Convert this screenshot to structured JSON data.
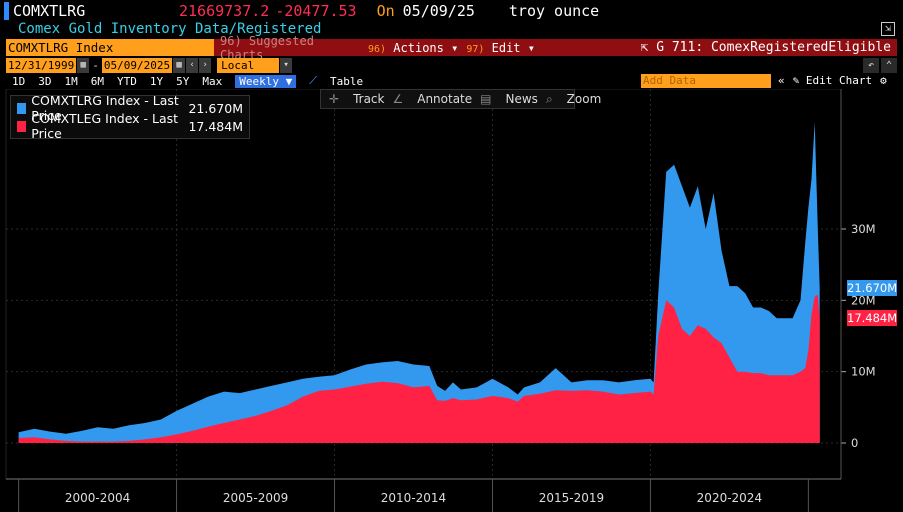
{
  "header": {
    "ticker": "COMXTLRG",
    "price": "21669737.2",
    "change": "-20477.53",
    "on_label": "On",
    "date": "05/09/25",
    "unit": "troy ounce",
    "subtitle": "Comex Gold Inventory Data/Registered"
  },
  "toolbar": {
    "security": "COMXTLRG Index",
    "suggested": "96) Suggested Charts",
    "actions_num": "96)",
    "actions": "Actions",
    "edit_num": "97)",
    "edit": "Edit",
    "graph_title": "G 711: ComexRegisteredEligible"
  },
  "range": {
    "start": "12/31/1999",
    "end": "05/09/2025",
    "currency": "Local CCY",
    "buttons": [
      "1D",
      "3D",
      "1M",
      "6M",
      "YTD",
      "1Y",
      "5Y",
      "Max"
    ],
    "frequency": "Weekly",
    "table": "Table",
    "add_data": "Add Data",
    "edit_chart": "Edit Chart"
  },
  "chart_tools": {
    "track": "Track",
    "annotate": "Annotate",
    "news": "News",
    "zoom": "Zoom"
  },
  "colors": {
    "registered": "#3399ee",
    "eligible": "#ff2244"
  },
  "chart_data": {
    "type": "area",
    "y_axis_side": "right",
    "ylim": [
      -1.2,
      46
    ],
    "y_ticks": [
      "0",
      "10M",
      "20M",
      "30M"
    ],
    "x_ticks": [
      "2000-2004",
      "2005-2009",
      "2010-2014",
      "2015-2019",
      "2020-2024"
    ],
    "x": [
      2000.0,
      2000.5,
      2001.0,
      2001.5,
      2002.0,
      2002.5,
      2003.0,
      2003.5,
      2004.0,
      2004.5,
      2005.0,
      2005.5,
      2006.0,
      2006.5,
      2007.0,
      2007.5,
      2008.0,
      2008.5,
      2009.0,
      2009.5,
      2010.0,
      2010.5,
      2011.0,
      2011.5,
      2012.0,
      2012.5,
      2013.0,
      2013.25,
      2013.5,
      2013.75,
      2014.0,
      2014.5,
      2015.0,
      2015.5,
      2015.8,
      2016.0,
      2016.5,
      2017.0,
      2017.5,
      2018.0,
      2018.5,
      2019.0,
      2019.5,
      2020.0,
      2020.1,
      2020.25,
      2020.5,
      2020.75,
      2021.0,
      2021.25,
      2021.5,
      2021.75,
      2022.0,
      2022.25,
      2022.5,
      2022.75,
      2023.0,
      2023.25,
      2023.5,
      2023.75,
      2024.0,
      2024.25,
      2024.5,
      2024.75,
      2024.9,
      2025.0,
      2025.1,
      2025.2,
      2025.3,
      2025.36
    ],
    "series": [
      {
        "name": "COMXTLRG Index - Last Price",
        "last": "21.670M",
        "values": [
          1.5,
          2.0,
          1.6,
          1.3,
          1.7,
          2.2,
          2.0,
          2.5,
          2.8,
          3.3,
          4.5,
          5.5,
          6.5,
          7.2,
          7.0,
          7.5,
          8.0,
          8.5,
          9.0,
          9.3,
          9.5,
          10.3,
          11.0,
          11.3,
          11.5,
          11.0,
          10.8,
          8.0,
          7.3,
          8.5,
          7.5,
          7.8,
          9.0,
          7.8,
          6.8,
          7.8,
          8.5,
          10.5,
          8.5,
          8.8,
          8.8,
          8.5,
          8.8,
          9.0,
          8.5,
          21.0,
          38.0,
          39.0,
          36.0,
          33.0,
          36.0,
          30.0,
          35.0,
          27.0,
          22.0,
          22.0,
          21.0,
          19.0,
          19.0,
          18.5,
          17.5,
          17.5,
          17.5,
          20.0,
          28.0,
          33.0,
          37.0,
          45.0,
          30.0,
          21.67
        ]
      },
      {
        "name": "COMXTLEG Index - Last Price",
        "last": "17.484M",
        "values": [
          0.7,
          0.8,
          0.5,
          0.3,
          0.2,
          0.2,
          0.2,
          0.3,
          0.5,
          0.8,
          1.2,
          1.7,
          2.3,
          2.8,
          3.3,
          3.8,
          4.5,
          5.3,
          6.5,
          7.3,
          7.5,
          7.9,
          8.3,
          8.6,
          8.4,
          7.8,
          8.0,
          6.0,
          5.9,
          6.3,
          6.0,
          6.1,
          6.6,
          6.3,
          5.8,
          6.6,
          6.9,
          7.4,
          7.3,
          7.4,
          7.2,
          6.8,
          7.0,
          7.2,
          6.8,
          15.0,
          20.0,
          19.0,
          16.0,
          15.0,
          16.5,
          16.0,
          14.8,
          14.0,
          12.0,
          10.0,
          10.0,
          9.8,
          9.8,
          9.5,
          9.5,
          9.5,
          9.5,
          10.0,
          10.5,
          13.0,
          18.0,
          20.5,
          20.8,
          17.484
        ]
      }
    ]
  }
}
